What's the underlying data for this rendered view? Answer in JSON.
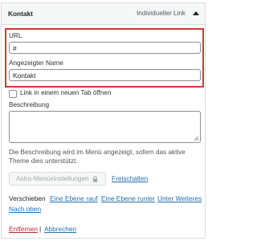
{
  "header": {
    "title": "Kontakt",
    "item_type": "Individueller Link"
  },
  "fields": {
    "url_label": "URL",
    "url_value": "#",
    "name_label": "Angezeigter Name",
    "name_value": "Kontakt",
    "new_tab_label": "Link in einem neuen Tab öffnen",
    "description_label": "Beschreibung",
    "description_value": "",
    "description_help": "Die Beschreibung wird im Menü angezeigt, sofern das aktive Theme dies unterstützt."
  },
  "astra": {
    "button_label": "Astra-Menüeinstellungen",
    "unlock_label": "Freischalten"
  },
  "move": {
    "label": "Verschieben",
    "up_one": "Eine Ebene rauf",
    "down_one": "Eine Ebene runter",
    "under": "Unter Weiteres",
    "to_top": "Nach oben"
  },
  "actions": {
    "remove": "Entfernen",
    "separator": "|",
    "cancel": "Abbrechen"
  },
  "colors": {
    "highlight": "#d63638",
    "link": "#2271b1",
    "delete": "#b32d2e"
  }
}
